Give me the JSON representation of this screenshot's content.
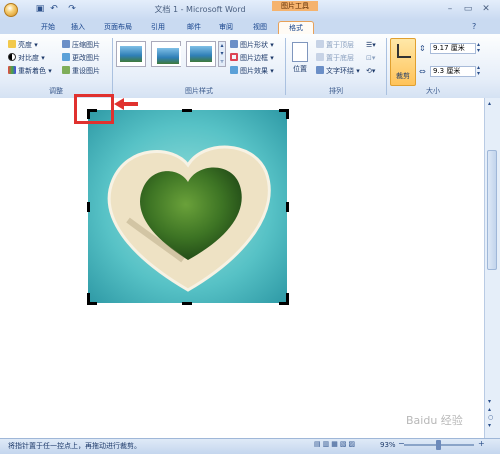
{
  "window": {
    "title": "文档 1 - Microsoft Word",
    "context_tab": "图片工具",
    "quick_access": [
      "save-icon",
      "undo-icon",
      "redo-icon"
    ],
    "controls": [
      "minimize-icon",
      "maximize-icon",
      "close-icon"
    ]
  },
  "tabs": [
    "开始",
    "插入",
    "页面布局",
    "引用",
    "邮件",
    "审阅",
    "视图",
    "格式"
  ],
  "active_tab": "格式",
  "ribbon": {
    "adjust": {
      "label": "调整",
      "brightness": "亮度",
      "contrast": "对比度",
      "recolor": "重新着色",
      "compress": "压缩图片",
      "change": "更改图片",
      "reset": "重设图片"
    },
    "styles": {
      "label": "图片样式",
      "shape": "图片形状",
      "border": "图片边框",
      "effects": "图片效果"
    },
    "arrange": {
      "label": "排列",
      "position": "位置",
      "bring_front": "置于顶层",
      "send_back": "置于底层",
      "text_wrap": "文字环绕"
    },
    "size": {
      "label": "大小",
      "crop": "裁剪",
      "height": "9.17 厘米",
      "width": "9.3 厘米"
    }
  },
  "status": {
    "text": "将指针置于任一控点上，再拖动进行裁剪。",
    "zoom": "93%"
  },
  "watermark": "Baidu 经验",
  "colors": {
    "accent": "#f5b36e",
    "annotation": "#e0312e",
    "ribbon_text": "#15428b"
  }
}
